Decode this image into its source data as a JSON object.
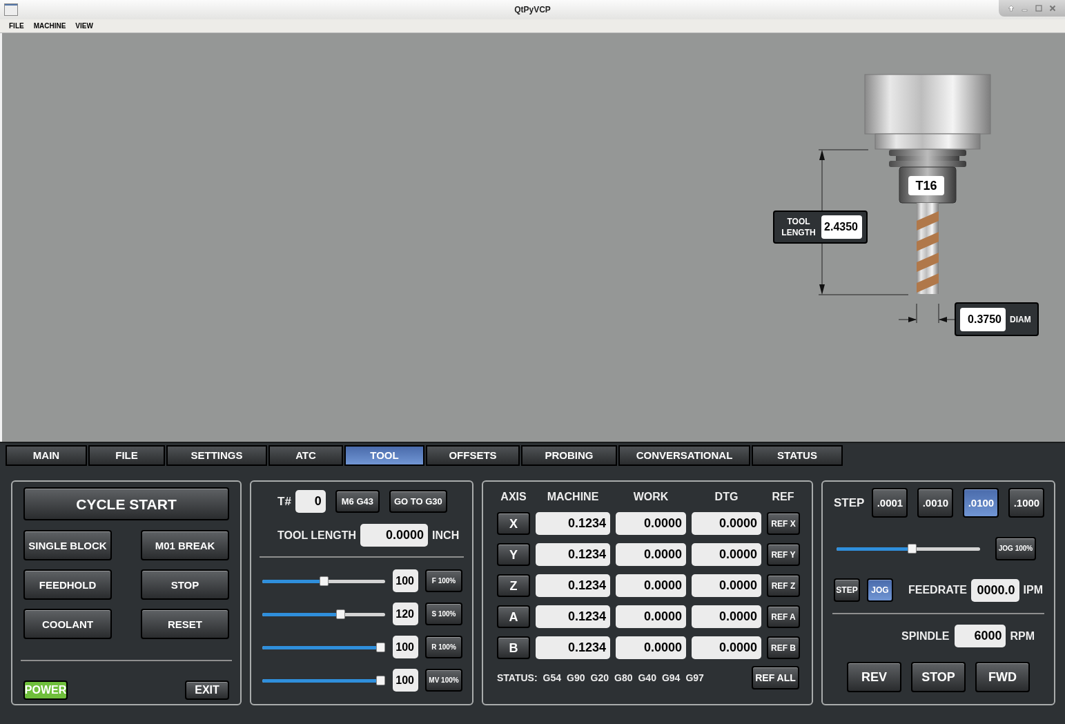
{
  "window": {
    "title": "QtPyVCP"
  },
  "menu": [
    {
      "label": "FILE"
    },
    {
      "label": "MACHINE"
    },
    {
      "label": "VIEW"
    }
  ],
  "tool_view": {
    "tool_number": "T16",
    "tool_length_label": "TOOL LENGTH",
    "tool_length": "2.4350",
    "diameter": "0.3750",
    "diameter_label": "DIAM"
  },
  "tabs": [
    {
      "label": "MAIN",
      "selected": false
    },
    {
      "label": "FILE",
      "selected": false
    },
    {
      "label": "SETTINGS",
      "selected": false
    },
    {
      "label": "ATC",
      "selected": false
    },
    {
      "label": "TOOL",
      "selected": true
    },
    {
      "label": "OFFSETS",
      "selected": false
    },
    {
      "label": "PROBING",
      "selected": false
    },
    {
      "label": "CONVERSATIONAL",
      "selected": false
    },
    {
      "label": "STATUS",
      "selected": false
    }
  ],
  "machine_panel": {
    "cycle_start": "CYCLE START",
    "buttons": [
      "SINGLE BLOCK",
      "M01 BREAK",
      "FEEDHOLD",
      "STOP",
      "COOLANT",
      "RESET"
    ],
    "power": {
      "label": "POWER",
      "on": true
    },
    "exit": "EXIT"
  },
  "tool_panel": {
    "tool_number_label": "T#",
    "tool_number": "0",
    "buttons": [
      "M6 G43",
      "GO TO G30"
    ],
    "tool_length_label": "TOOL LENGTH",
    "tool_length": "0.0000",
    "unit": "INCH",
    "overrides": [
      {
        "level": 0.5,
        "value": "100",
        "button": "F 100%"
      },
      {
        "level": 0.65,
        "value": "120",
        "button": "S 100%"
      },
      {
        "level": 1,
        "value": "100",
        "button": "R 100%"
      },
      {
        "level": 1,
        "value": "100",
        "button": "MV 100%"
      }
    ]
  },
  "dro": {
    "columns": [
      "AXIS",
      "MACHINE",
      "WORK",
      "DTG",
      "REF"
    ],
    "rows": [
      {
        "axis": "X",
        "machine": "0.1234",
        "work": "0.0000",
        "dtg": "0.0000",
        "ref": "REF X"
      },
      {
        "axis": "Y",
        "machine": "0.1234",
        "work": "0.0000",
        "dtg": "0.0000",
        "ref": "REF Y"
      },
      {
        "axis": "Z",
        "machine": "0.1234",
        "work": "0.0000",
        "dtg": "0.0000",
        "ref": "REF Z"
      },
      {
        "axis": "A",
        "machine": "0.1234",
        "work": "0.0000",
        "dtg": "0.0000",
        "ref": "REF A"
      },
      {
        "axis": "B",
        "machine": "0.1234",
        "work": "0.0000",
        "dtg": "0.0000",
        "ref": "REF B"
      }
    ],
    "status_label": "STATUS:",
    "status_codes": [
      "G54",
      "G90",
      "G20",
      "G80",
      "G40",
      "G94",
      "G97"
    ],
    "ref_all": "REF ALL"
  },
  "jog_panel": {
    "step_label": "STEP",
    "steps": [
      {
        "label": ".0001",
        "selected": false
      },
      {
        "label": ".0010",
        "selected": false
      },
      {
        "label": ".0100",
        "selected": true
      },
      {
        "label": ".1000",
        "selected": false
      }
    ],
    "jog_slider": {
      "level": 0.53
    },
    "jog_button": "JOG 100%",
    "modes": [
      {
        "label": "STEP",
        "selected": false
      },
      {
        "label": "JOG",
        "selected": true
      }
    ],
    "feedrate_label": "FEEDRATE",
    "feedrate": "0000.0",
    "feedrate_unit": "IPM",
    "spindle_label": "SPINDLE",
    "spindle": "6000",
    "spindle_unit": "RPM",
    "spindle_buttons": [
      "REV",
      "STOP",
      "FWD"
    ]
  }
}
